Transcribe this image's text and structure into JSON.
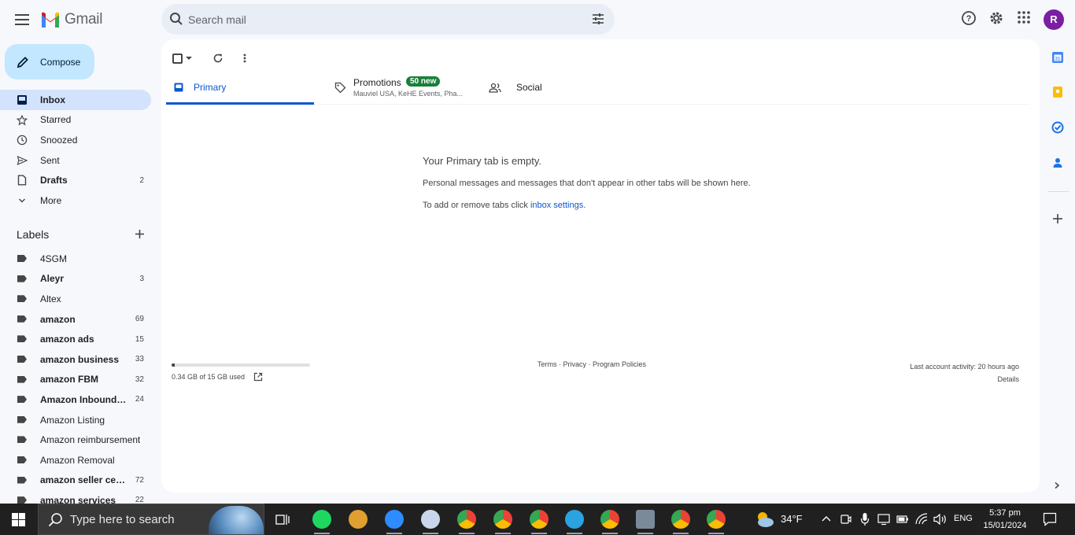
{
  "header": {
    "app_name": "Gmail",
    "search_placeholder": "Search mail",
    "avatar_initial": "R"
  },
  "compose": {
    "label": "Compose"
  },
  "nav": {
    "items": [
      {
        "label": "Inbox",
        "count": "",
        "icon": "inbox-icon",
        "active": true
      },
      {
        "label": "Starred",
        "count": "",
        "icon": "star-icon"
      },
      {
        "label": "Snoozed",
        "count": "",
        "icon": "clock-icon"
      },
      {
        "label": "Sent",
        "count": "",
        "icon": "send-icon"
      },
      {
        "label": "Drafts",
        "count": "2",
        "icon": "draft-icon",
        "bold": true
      },
      {
        "label": "More",
        "count": "",
        "icon": "chevron-down-icon"
      }
    ]
  },
  "labels": {
    "title": "Labels",
    "items": [
      {
        "label": "4SGM",
        "count": ""
      },
      {
        "label": "Aleyr",
        "count": "3",
        "bold": true
      },
      {
        "label": "Altex",
        "count": ""
      },
      {
        "label": "amazon",
        "count": "69",
        "bold": true
      },
      {
        "label": "amazon ads",
        "count": "15",
        "bold": true
      },
      {
        "label": "amazon business",
        "count": "33",
        "bold": true
      },
      {
        "label": "amazon FBM",
        "count": "32",
        "bold": true
      },
      {
        "label": "Amazon Inbound ...",
        "count": "24",
        "bold": true
      },
      {
        "label": "Amazon Listing",
        "count": ""
      },
      {
        "label": "Amazon reimbursement",
        "count": ""
      },
      {
        "label": "Amazon Removal",
        "count": ""
      },
      {
        "label": "amazon seller cen...",
        "count": "72",
        "bold": true
      },
      {
        "label": "amazon services",
        "count": "22",
        "bold": true
      }
    ]
  },
  "tabs": {
    "primary": "Primary",
    "promotions": "Promotions",
    "promotions_badge": "50 new",
    "promotions_senders": "Mauviel USA, KeHE Events, Pha...",
    "social": "Social"
  },
  "empty": {
    "title": "Your Primary tab is empty.",
    "text": "Personal messages and messages that don't appear in other tabs will be shown here.",
    "text2_prefix": "To add or remove tabs click ",
    "text2_link": "inbox settings",
    "text2_suffix": "."
  },
  "footer": {
    "storage_text": "0.34 GB of 15 GB used",
    "storage_fraction": 0.023,
    "terms": "Terms",
    "privacy": "Privacy",
    "policies": "Program Policies",
    "sep": " · ",
    "activity": "Last account activity: 20 hours ago",
    "details": "Details"
  },
  "taskbar": {
    "search_placeholder": "Type here to search",
    "temperature": "34°F",
    "language": "ENG",
    "time": "5:37 pm",
    "date": "15/01/2024"
  },
  "colors": {
    "accent": "#0b57d0",
    "compose_bg": "#c2e7ff",
    "active_nav": "#d3e3fd",
    "badge": "#188038",
    "avatar": "#7b1fa2"
  }
}
